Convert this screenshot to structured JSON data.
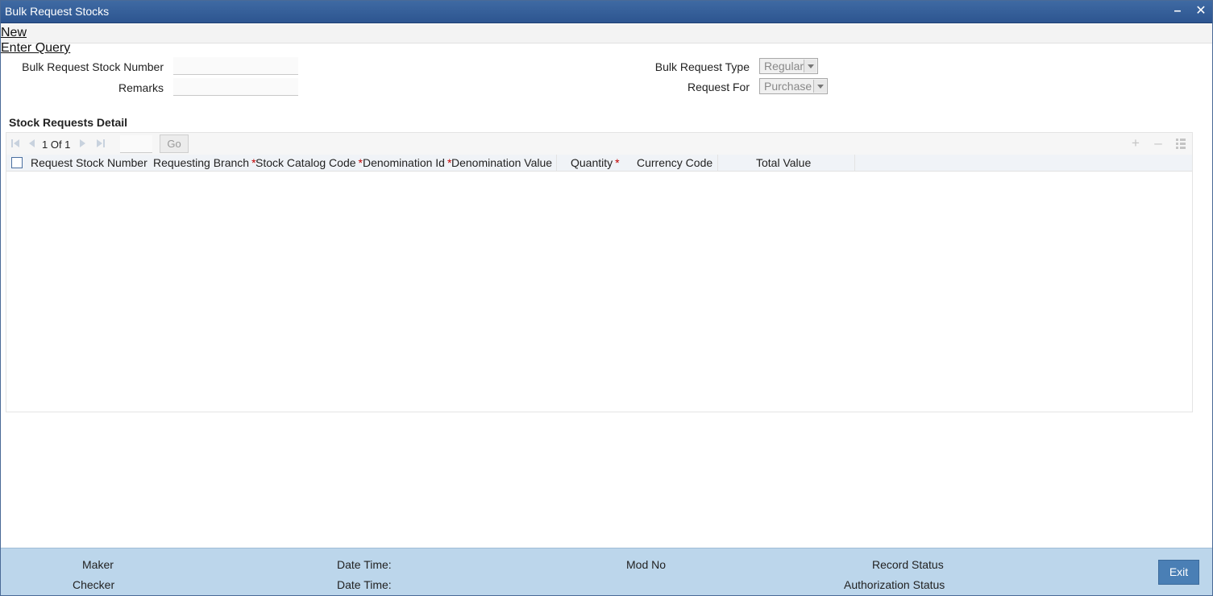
{
  "window": {
    "title": "Bulk Request Stocks"
  },
  "menu": {
    "new_label": "New",
    "enter_query_label": "Enter Query"
  },
  "form": {
    "bulk_request_stock_number_label": "Bulk Request Stock Number",
    "bulk_request_stock_number_value": "",
    "remarks_label": "Remarks",
    "remarks_value": "",
    "bulk_request_type_label": "Bulk Request Type",
    "bulk_request_type_value": "Regular",
    "request_for_label": "Request For",
    "request_for_value": "Purchase"
  },
  "section": {
    "title": "Stock Requests Detail"
  },
  "grid": {
    "pager_text": "1 Of 1",
    "go_label": "Go",
    "columns": [
      {
        "label": "Request Stock Number",
        "required": false
      },
      {
        "label": "Requesting Branch",
        "required": true
      },
      {
        "label": "Stock Catalog Code",
        "required": true
      },
      {
        "label": "Denomination Id",
        "required": true
      },
      {
        "label": "Denomination Value",
        "required": false
      },
      {
        "label": "Quantity",
        "required": true
      },
      {
        "label": "Currency Code",
        "required": false
      },
      {
        "label": "Total Value",
        "required": false
      }
    ],
    "required_mark": "*",
    "rows": []
  },
  "footer": {
    "maker_label": "Maker",
    "checker_label": "Checker",
    "date_time_label_1": "Date Time:",
    "date_time_label_2": "Date Time:",
    "mod_no_label": "Mod No",
    "record_status_label": "Record Status",
    "authorization_status_label": "Authorization Status",
    "exit_label": "Exit"
  },
  "colors": {
    "titlebar": "#2d5590",
    "footer": "#bcd6eb",
    "exit_button": "#4a7fb5",
    "required": "#c00000"
  }
}
